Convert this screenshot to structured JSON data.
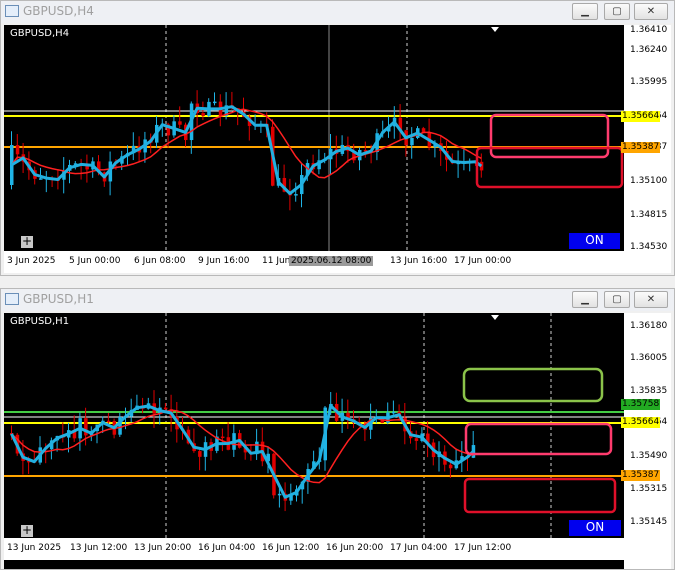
{
  "windows": [
    {
      "id": "h4",
      "title": "GBPUSD,H4",
      "symbol_label": "GBPUSD,H4",
      "on_label": "ON",
      "y_ticks": [
        "1.36410",
        "1.36240",
        "1.35995",
        "1.35664",
        "1.35387",
        "1.35100",
        "1.34815",
        "1.34530"
      ],
      "x_ticks": [
        "3 Jun 2025",
        "5 Jun 00:00",
        "6 Jun 08:00",
        "9 Jun 16:00",
        "11 Jun",
        "2025.06.12 08:00",
        "13 Jun 16:00",
        "17 Jun 00:00"
      ],
      "price_labels": [
        {
          "value": "1.35664",
          "color": "#ffff00"
        },
        {
          "value": "1.35387",
          "color": "#ffa500"
        }
      ]
    },
    {
      "id": "h1",
      "title": "GBPUSD,H1",
      "symbol_label": "GBPUSD,H1",
      "on_label": "ON",
      "y_ticks": [
        "1.36180",
        "1.36005",
        "1.35835",
        "1.35664",
        "1.35490",
        "1.35315",
        "1.35145"
      ],
      "x_ticks": [
        "13 Jun 2025",
        "13 Jun 12:00",
        "13 Jun 20:00",
        "16 Jun 04:00",
        "16 Jun 12:00",
        "16 Jun 20:00",
        "17 Jun 04:00",
        "17 Jun 12:00"
      ],
      "price_labels": [
        {
          "value": "1.35758",
          "color": "#22aa22"
        },
        {
          "value": "1.35664",
          "color": "#ffff00"
        },
        {
          "value": "1.35387",
          "color": "#ffa500"
        }
      ]
    }
  ],
  "colors": {
    "bull": "#1fb4e6",
    "bear": "#e00000",
    "ma": "#ff2020",
    "zigzag": "#22b0e0",
    "yellow": "#ffff00",
    "orange": "#ffa500",
    "green": "#44cc44"
  }
}
